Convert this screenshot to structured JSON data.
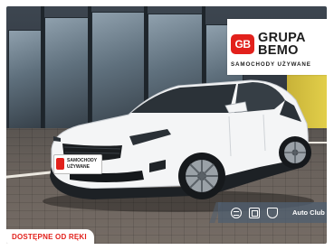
{
  "logo": {
    "mark": "GB",
    "line1": "GRUPA",
    "line2": "BEMO",
    "tagline": "SAMOCHODY UŻYWANE"
  },
  "plate": {
    "line1": "SAMOCHODY",
    "line2": "UŻYWANE"
  },
  "banner": {
    "icons": [
      "citroen-logo-icon",
      "opel-logo-icon",
      "peugeot-logo-icon"
    ],
    "text": "Auto Club"
  },
  "badge": {
    "text": "DOSTĘPNE OD RĘKI"
  },
  "colors": {
    "accent": "#e2211c",
    "car_body": "#f4f5f6",
    "banner_bg": "#505f70"
  }
}
